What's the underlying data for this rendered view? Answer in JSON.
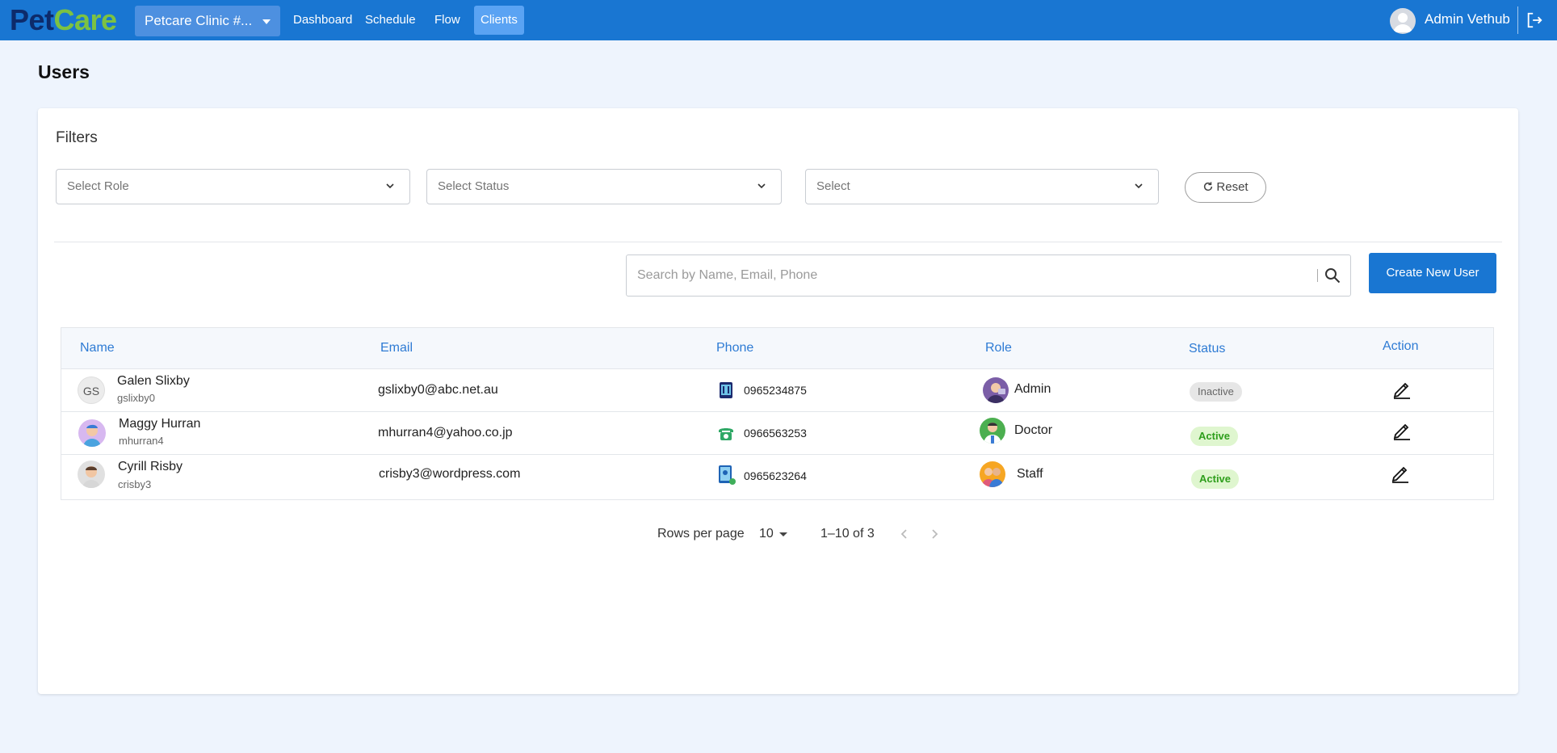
{
  "header": {
    "logo_part1": "Pet",
    "logo_part2": "Care",
    "clinic": "Petcare Clinic #...",
    "nav": [
      {
        "label": "Dashboard"
      },
      {
        "label": "Schedule"
      },
      {
        "label": "Flow"
      },
      {
        "label": "Clients"
      }
    ],
    "active_nav": "Clients",
    "user_name": "Admin Vethub",
    "colors": {
      "bar": "#1976d2",
      "active_nav": "#5aa3f3",
      "logo_pet": "#0d2b6b",
      "logo_care": "#7cc242"
    }
  },
  "page": {
    "title": "Users"
  },
  "filters": {
    "title": "Filters",
    "role_placeholder": "Select Role",
    "status_placeholder": "Select Status",
    "third_placeholder": "Select",
    "reset_label": "Reset"
  },
  "search": {
    "placeholder": "Search by Name, Email, Phone",
    "value": ""
  },
  "create_button": "Create New User",
  "table": {
    "columns": [
      "Name",
      "Email",
      "Phone",
      "Role",
      "Status",
      "Action"
    ],
    "rows": [
      {
        "initials": "GS",
        "name": "Galen Slixby",
        "username": "gslixby0",
        "email": "gslixby0@abc.net.au",
        "phone": "0965234875",
        "phone_icon": "mobile-phone-icon",
        "role": "Admin",
        "role_icon": "admin-avatar-icon",
        "status": "Inactive"
      },
      {
        "initials": "",
        "name": "Maggy Hurran",
        "username": "mhurran4",
        "email": "mhurran4@yahoo.co.jp",
        "phone": "0966563253",
        "phone_icon": "landline-phone-icon",
        "role": "Doctor",
        "role_icon": "doctor-avatar-icon",
        "status": "Active"
      },
      {
        "initials": "",
        "name": "Cyrill Risby",
        "username": "crisby3",
        "email": "crisby3@wordpress.com",
        "phone": "0965623264",
        "phone_icon": "contact-phone-icon",
        "role": "Staff",
        "role_icon": "staff-avatar-icon",
        "status": "Active"
      }
    ]
  },
  "pagination": {
    "rows_per_page_label": "Rows per page",
    "rows_per_page": "10",
    "range": "1–10 of 3"
  }
}
